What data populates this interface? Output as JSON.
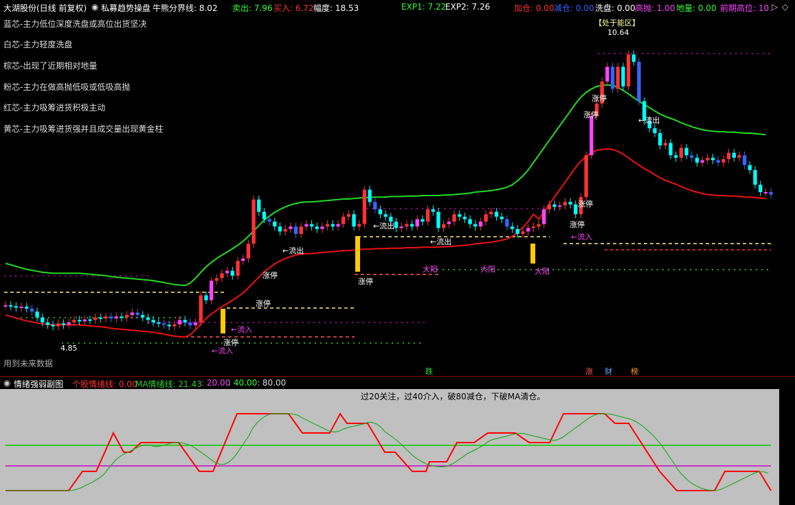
{
  "header": {
    "stock": "大湖股份(日线 前复权)",
    "indicator": "私募趋势操盘",
    "line_label": "牛熊分界线: 8.02",
    "sell": "卖出: 7.96",
    "buy": "买入: 6.72",
    "amplitude": "幅度: 18.53",
    "exp1": "EXP1: 7.22",
    "exp2": "EXP2: 7.26",
    "add": "加仓: 0.00",
    "reduce": "减仓: 0.00",
    "wash": "洗盘: 0.00",
    "high_sell": "高抛: 1.00",
    "ground": "地量: 0.00",
    "prev_high": "前期高位: 10."
  },
  "legend": [
    {
      "text": "蓝芯-主力低位深度洗盘或高位出货坚决",
      "color": "#3366ff"
    },
    {
      "text": "白芯-主力轻度洗盘",
      "color": "#ffffff"
    },
    {
      "text": "棕芯-出现了近期相对地量",
      "color": "#33dd33"
    },
    {
      "text": "粉芯-主力在做高抛低吸或低吸高抛",
      "color": "#ff44ff"
    },
    {
      "text": "红芯-主力吸筹进货积极主动",
      "color": "#ff3333"
    },
    {
      "text": "黄芯-主力吸筹进货强并且成交量出现黄金柱",
      "color": "#ffff33"
    }
  ],
  "annotations": {
    "energy_zone": "【处于能区】",
    "peak_price": "10.64",
    "low_price": "4.85",
    "future": "用到未来数据",
    "limit_up": "涨停",
    "inflow": "流入",
    "outflow": "流出",
    "big_yang": "大阳",
    "die": "跌",
    "zhang": "涨",
    "cai": "财",
    "bang": "榜"
  },
  "sub": {
    "title": "情绪强弱副图",
    "stock_mood": "个股情绪线: 0.00",
    "ma_mood": "MA情绪线: 21.43",
    "v20": ": 20.00",
    "v40": ": 40.00",
    "v80": ": 80.00",
    "note": "过20关注，过40介入，破80减仓，下破MA清仓。"
  },
  "colors": {
    "up": "#ff3333",
    "down": "#00ffff",
    "blue": "#3366ff",
    "mood": "#ff0000",
    "ma": "#22aa22",
    "l40": "#00cc00",
    "l20": "#cc00cc"
  },
  "chart_data": {
    "type": "candlestick",
    "title": "大湖股份(日线 前复权)",
    "ylim": [
      4.3,
      11.0
    ],
    "close": [
      5.35,
      5.33,
      5.3,
      5.32,
      5.28,
      5.22,
      5.1,
      5.0,
      4.95,
      4.92,
      4.98,
      4.95,
      5.0,
      5.05,
      5.02,
      5.06,
      5.05,
      5.1,
      5.08,
      5.12,
      5.08,
      5.12,
      5.1,
      5.15,
      5.2,
      5.15,
      5.1,
      5.05,
      5.0,
      4.98,
      4.95,
      4.92,
      4.96,
      5.05,
      5.0,
      4.94,
      5.0,
      5.55,
      5.45,
      5.85,
      5.9,
      6.0,
      6.05,
      5.95,
      6.25,
      6.3,
      6.6,
      7.5,
      7.25,
      7.1,
      7.05,
      6.95,
      6.85,
      6.9,
      6.95,
      6.8,
      6.95,
      7.0,
      6.95,
      6.9,
      6.95,
      7.0,
      6.95,
      7.0,
      7.15,
      7.2,
      6.95,
      7.0,
      7.7,
      7.45,
      7.3,
      7.2,
      7.15,
      7.05,
      6.92,
      6.95,
      7.0,
      6.95,
      7.1,
      7.05,
      7.3,
      7.25,
      6.92,
      7.0,
      7.05,
      7.2,
      7.15,
      7.1,
      7.0,
      6.95,
      7.05,
      7.2,
      7.25,
      7.15,
      7.1,
      6.95,
      6.9,
      6.8,
      6.85,
      6.92,
      6.95,
      7.0,
      7.3,
      7.4,
      7.35,
      7.38,
      7.45,
      7.4,
      7.2,
      7.55,
      8.4,
      9.2,
      9.45,
      9.9,
      10.2,
      9.75,
      10.2,
      9.8,
      10.45,
      10.3,
      9.5,
      9.1,
      8.95,
      8.85,
      8.6,
      8.65,
      8.4,
      8.35,
      8.55,
      8.4,
      8.35,
      8.25,
      8.3,
      8.35,
      8.3,
      8.25,
      8.32,
      8.45,
      8.35,
      8.4,
      8.2,
      8.1,
      7.8,
      7.65,
      7.65,
      7.6
    ],
    "ma_green": [
      6.2,
      6.17,
      6.14,
      6.11,
      6.08,
      6.06,
      6.04,
      6.02,
      6.01,
      6.0,
      6.0,
      6.0,
      6.0,
      6.0,
      6.0,
      5.99,
      5.98,
      5.97,
      5.96,
      5.95,
      5.93,
      5.92,
      5.91,
      5.9,
      5.89,
      5.88,
      5.87,
      5.86,
      5.85,
      5.83,
      5.81,
      5.79,
      5.77,
      5.76,
      5.75,
      5.8,
      5.9,
      6.02,
      6.13,
      6.22,
      6.3,
      6.37,
      6.43,
      6.5,
      6.57,
      6.65,
      6.75,
      6.86,
      6.97,
      7.08,
      7.16,
      7.24,
      7.3,
      7.35,
      7.39,
      7.42,
      7.44,
      7.45,
      7.45,
      7.46,
      7.47,
      7.48,
      7.49,
      7.5,
      7.51,
      7.51,
      7.52,
      7.53,
      7.54,
      7.54,
      7.55,
      7.55,
      7.55,
      7.56,
      7.56,
      7.56,
      7.57,
      7.57,
      7.57,
      7.58,
      7.58,
      7.58,
      7.58,
      7.59,
      7.59,
      7.6,
      7.61,
      7.62,
      7.63,
      7.65,
      7.66,
      7.67,
      7.68,
      7.7,
      7.72,
      7.75,
      7.8,
      7.88,
      7.98,
      8.1,
      8.25,
      8.4,
      8.55,
      8.7,
      8.85,
      9.0,
      9.15,
      9.3,
      9.45,
      9.58,
      9.68,
      9.75,
      9.8,
      9.82,
      9.83,
      9.82,
      9.78,
      9.72,
      9.65,
      9.57,
      9.5,
      9.43,
      9.37,
      9.3,
      9.24,
      9.19,
      9.15,
      9.11,
      9.06,
      9.02,
      8.98,
      8.95,
      8.92,
      8.9,
      8.89,
      8.88,
      8.88,
      8.87,
      8.87,
      8.86,
      8.85,
      8.85,
      8.84,
      8.83,
      8.82
    ]
  }
}
